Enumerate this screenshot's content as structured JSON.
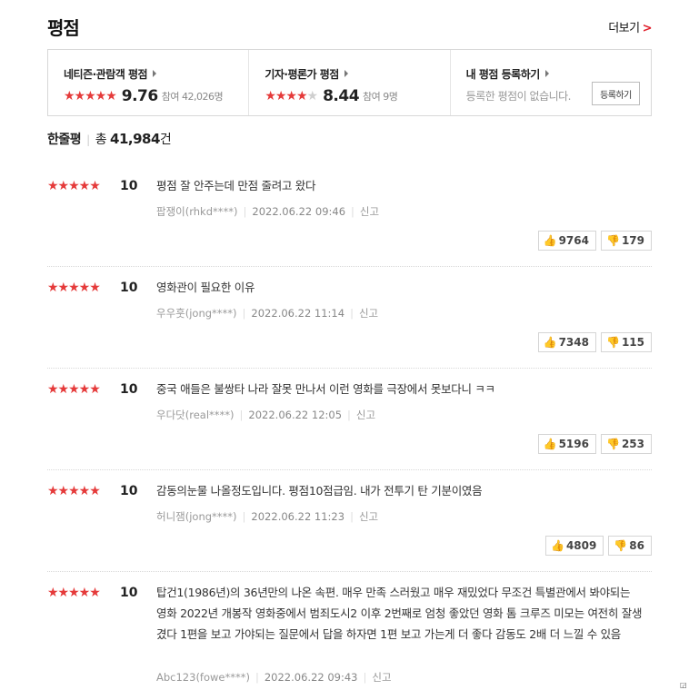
{
  "section_title": "평점",
  "more_label": "더보기",
  "more_chevron": ">",
  "summary": {
    "netizen": {
      "title": "네티즌·관람객 평점",
      "stars_on": "★★★★★",
      "stars_off": "",
      "score": "9.76",
      "count": "참여 42,026명"
    },
    "critic": {
      "title": "기자·평론가 평점",
      "stars_on": "★★★★",
      "stars_off": "★",
      "score": "8.44",
      "count": "참여 9명"
    },
    "mine": {
      "title": "내 평점 등록하기",
      "text": "등록한 평점이 없습니다.",
      "button": "등록하기"
    }
  },
  "total": {
    "label": "한줄평",
    "prefix": "총",
    "count": "41,984",
    "suffix": "건"
  },
  "reviews": [
    {
      "stars": "★★★★★",
      "score": "10",
      "text": "평점 잘 안주는데 만점 줄려고 왔다",
      "user": "팝쟁이(rhkd****)",
      "date": "2022.06.22 09:46",
      "report": "신고",
      "likes": "9764",
      "dislikes": "179"
    },
    {
      "stars": "★★★★★",
      "score": "10",
      "text": "영화관이 필요한 이유",
      "user": "우우훗(jong****)",
      "date": "2022.06.22 11:14",
      "report": "신고",
      "likes": "7348",
      "dislikes": "115"
    },
    {
      "stars": "★★★★★",
      "score": "10",
      "text": "중국 애들은 불쌍타 나라 잘못 만나서 이런 영화를 극장에서 못보다니 ㅋㅋ",
      "user": "우다닷(real****)",
      "date": "2022.06.22 12:05",
      "report": "신고",
      "likes": "5196",
      "dislikes": "253"
    },
    {
      "stars": "★★★★★",
      "score": "10",
      "text": "감동의눈물 나올정도입니다. 평점10점급임. 내가 전투기 탄 기분이였음",
      "user": "허니잼(jong****)",
      "date": "2022.06.22 11:23",
      "report": "신고",
      "likes": "4809",
      "dislikes": "86"
    },
    {
      "stars": "★★★★★",
      "score": "10",
      "text": "탑건1(1986년)의 36년만의 나온 속편. 매우 만족 스러웠고 매우 재밌었다 무조건 특별관에서 봐야되는 영화 2022년 개봉작 영화중에서 범죄도시2 이후 2번째로 엄청 좋았던 영화 톰 크루즈 미모는 여전히 잘생겼다 1편을 보고 가야되는 질문에서 답을 하자면 1편 보고 가는게 더 좋다 감동도 2배 더 느낄 수 있음",
      "user": "Abc123(fowe****)",
      "date": "2022.06.22 09:43",
      "report": "신고"
    }
  ],
  "icons": {
    "like": "thumbs-up-icon",
    "dislike": "thumbs-down-icon",
    "star_color": "#e53a3a",
    "accent": "#e0202c"
  }
}
